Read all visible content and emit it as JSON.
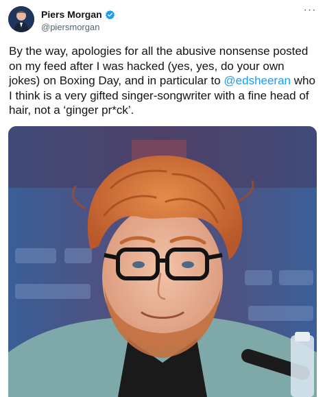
{
  "tweet": {
    "author": {
      "display_name": "Piers Morgan",
      "handle": "@piersmorgan",
      "verified": true,
      "avatar_icon": "profile-photo"
    },
    "more_icon": "more-options-icon",
    "text": {
      "part1": "By the way, apologies for all the abusive nonsense posted on my feed after I was hacked (yes, yes, do your own jokes) on Boxing Day, and in particular to ",
      "mention": "@edsheeran",
      "part2": " who I think is a very gifted singer-songwriter with a fine head of hair, not a ‘ginger pr*ck’."
    },
    "media": {
      "description_icon": "photo-of-ed-sheeran"
    },
    "colors": {
      "link": "#1d9bf0",
      "verified": "#1d9bf0",
      "secondary_text": "#536471"
    }
  }
}
